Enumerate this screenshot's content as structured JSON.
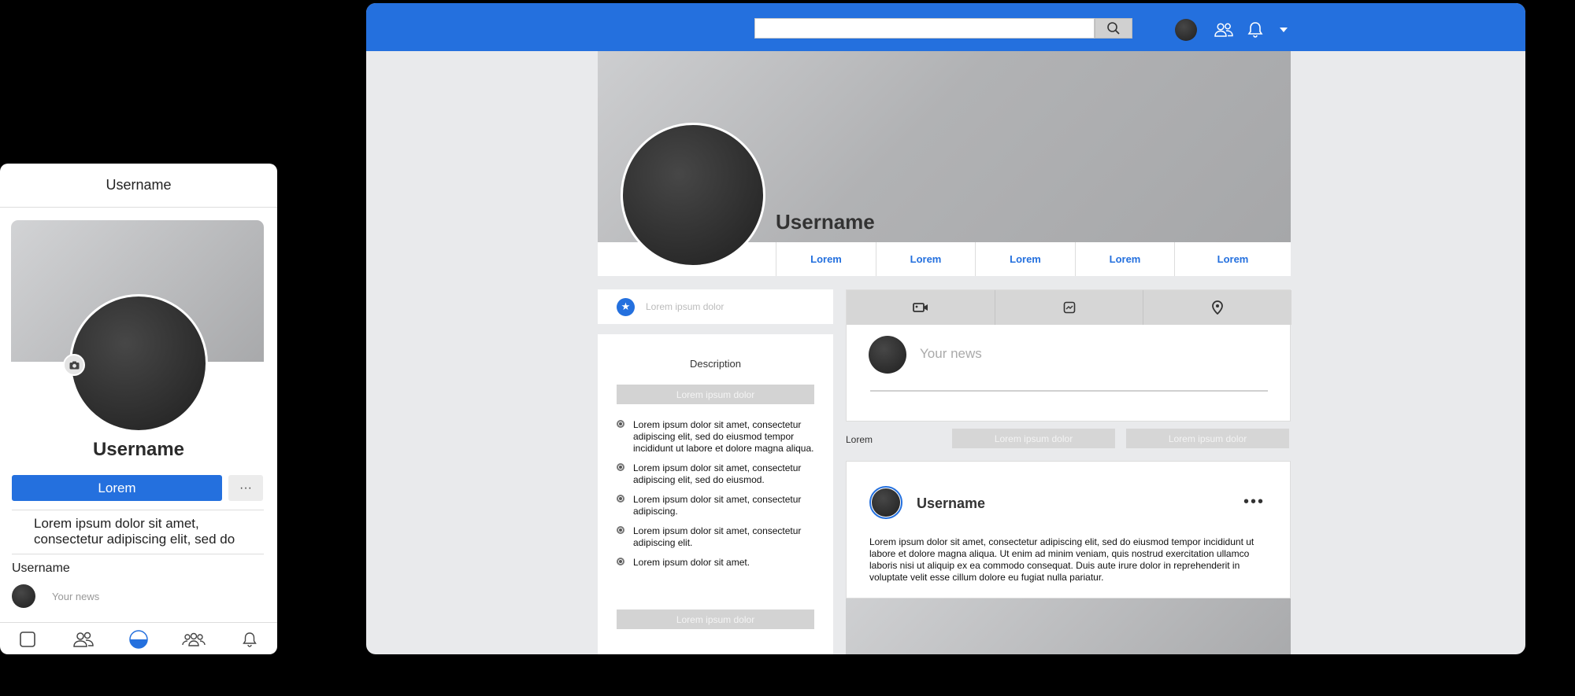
{
  "mobile": {
    "header_title": "Username",
    "profile_name": "Username",
    "primary_button": "Lorem",
    "more_button": "···",
    "bio": "Lorem ipsum dolor sit amet, consectetur adipiscing elit, sed do",
    "composer_user": "Username",
    "composer_placeholder": "Your news",
    "nav_icons": [
      "square-icon",
      "friends-icon",
      "profile-icon",
      "groups-icon",
      "bell-icon"
    ]
  },
  "desktop": {
    "search": {
      "placeholder": "",
      "icon": "search-icon"
    },
    "topbar_icons": [
      "avatar",
      "friends-icon",
      "bell-icon",
      "chevron-down-icon"
    ],
    "profile_name": "Username",
    "tabs": [
      "Lorem",
      "Lorem",
      "Lorem",
      "Lorem",
      "Lorem"
    ],
    "intro_text": "Lorem ipsum dolor",
    "description": {
      "title": "Description",
      "top_button": "Lorem ipsum dolor",
      "items": [
        "Lorem ipsum dolor sit amet, consectetur adipiscing elit, sed do eiusmod tempor incididunt ut labore et dolore magna aliqua.",
        "Lorem ipsum dolor sit amet, consectetur adipiscing elit, sed do eiusmod.",
        "Lorem ipsum dolor sit amet, consectetur adipiscing.",
        "Lorem ipsum dolor sit amet, consectetur adipiscing elit.",
        "Lorem ipsum dolor sit amet."
      ],
      "bottom_button": "Lorem ipsum dolor"
    },
    "composer": {
      "tab_icons": [
        "video-icon",
        "photo-icon",
        "location-icon"
      ],
      "placeholder": "Your news"
    },
    "filter": {
      "label": "Lorem",
      "buttons": [
        "Lorem ipsum dolor",
        "Lorem ipsum dolor"
      ]
    },
    "post": {
      "author": "Username",
      "menu": "•••",
      "body": "Lorem ipsum dolor sit amet, consectetur adipiscing elit, sed do eiusmod tempor incididunt ut labore et dolore magna aliqua. Ut enim ad minim veniam, quis nostrud exercitation ullamco laboris nisi ut aliquip ex ea commodo consequat. Duis aute irure dolor in reprehenderit in voluptate velit esse cillum dolore eu fugiat nulla pariatur."
    }
  },
  "colors": {
    "accent": "#2470de",
    "page_bg": "#e9eaec",
    "backdrop": "#000000"
  }
}
